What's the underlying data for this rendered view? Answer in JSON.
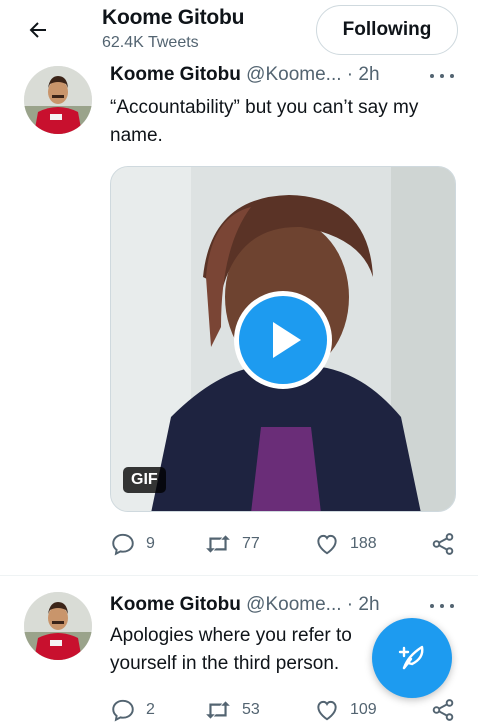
{
  "header": {
    "title": "Koome Gitobu",
    "subtitle": "62.4K Tweets",
    "follow_label": "Following",
    "back_icon": "arrow-left-icon"
  },
  "tweets": [
    {
      "name": "Koome Gitobu",
      "handle": "@Koome...",
      "time": "· 2h",
      "text": "“Accountability” but you can’t say my name.",
      "media": {
        "badge": "GIF",
        "play_icon": "play-icon"
      },
      "replies": "9",
      "retweets": "77",
      "likes": "188"
    },
    {
      "name": "Koome Gitobu",
      "handle": "@Koome...",
      "time": "· 2h",
      "text": "Apologies where you refer to yourself in the third person.",
      "replies": "2",
      "retweets": "53",
      "likes": "109"
    }
  ],
  "icons": [
    "arrow-left-icon",
    "more-icon",
    "reply-icon",
    "retweet-icon",
    "like-icon",
    "share-icon",
    "compose-icon",
    "play-icon"
  ],
  "colors": {
    "accent": "#1d9bf0",
    "muted": "#536471",
    "text": "#0f1419",
    "border": "#cfd9de"
  }
}
